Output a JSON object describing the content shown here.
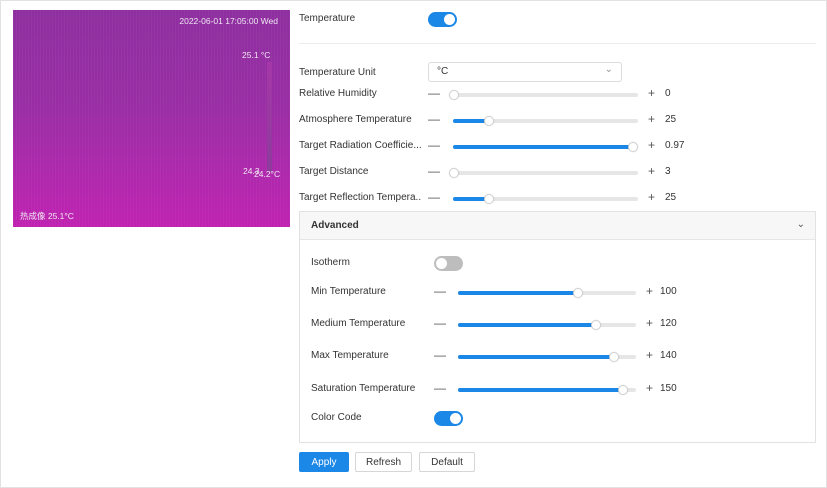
{
  "preview": {
    "timestamp": "2022-06-01 17:05:00 Wed",
    "temp_top": "25.1 °C",
    "temp_mid_a": "24.3",
    "temp_mid_b": "24.2°C",
    "camera_label": "热成像 25.1°C"
  },
  "temperature": {
    "label": "Temperature",
    "enabled": true
  },
  "unit": {
    "label": "Temperature Unit",
    "value": "°C"
  },
  "params": [
    {
      "label": "Relative Humidity",
      "value": "0",
      "fraction": 0.0
    },
    {
      "label": "Atmosphere Temperature",
      "value": "25",
      "fraction": 0.19
    },
    {
      "label": "Target Radiation Coefficie...",
      "value": "0.97",
      "fraction": 0.97
    },
    {
      "label": "Target Distance",
      "value": "3",
      "fraction": 0.0
    },
    {
      "label": "Target Reflection Tempera...",
      "value": "25",
      "fraction": 0.19
    }
  ],
  "advanced": {
    "title": "Advanced",
    "isotherm": {
      "label": "Isotherm",
      "enabled": false
    },
    "sliders": [
      {
        "label": "Min Temperature",
        "value": "100",
        "fraction": 0.67
      },
      {
        "label": "Medium Temperature",
        "value": "120",
        "fraction": 0.77
      },
      {
        "label": "Max Temperature",
        "value": "140",
        "fraction": 0.87
      },
      {
        "label": "Saturation Temperature",
        "value": "150",
        "fraction": 0.92
      }
    ],
    "color_code": {
      "label": "Color Code",
      "enabled": true
    }
  },
  "buttons": {
    "apply": "Apply",
    "refresh": "Refresh",
    "default": "Default"
  },
  "symbols": {
    "minus": "—",
    "plus": "+",
    "chevron": "⌄"
  },
  "colors": {
    "accent": "#1b87e6",
    "thermal": "#9a2ea4"
  }
}
